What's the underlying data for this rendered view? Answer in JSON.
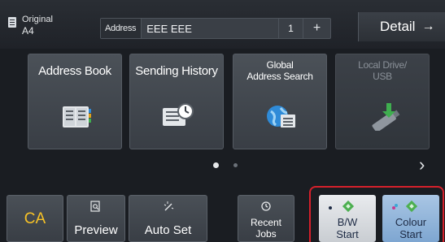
{
  "topbar": {
    "original_label": "Original",
    "original_size": "A4",
    "address_tag": "Address",
    "address_value": "EEE EEE",
    "address_count": "1",
    "add_symbol": "+",
    "detail_label": "Detail",
    "detail_arrow": "→"
  },
  "tiles": [
    {
      "name": "Address Book",
      "icon": "address-book-icon",
      "enabled": true
    },
    {
      "name": "Sending History",
      "icon": "sending-history-icon",
      "enabled": true
    },
    {
      "name_line1": "Global",
      "name_line2": "Address Search",
      "icon": "global-address-search-icon",
      "enabled": true
    },
    {
      "name_line1": "Local Drive/",
      "name_line2": "USB",
      "icon": "usb-drive-icon",
      "enabled": false
    }
  ],
  "pager": {
    "current": 1,
    "total": 2,
    "next_symbol": "›"
  },
  "bottombar": {
    "ca_label": "CA",
    "preview_label": "Preview",
    "autoset_label": "Auto Set",
    "recent_line1": "Recent",
    "recent_line2": "Jobs",
    "bw_line1": "B/W",
    "bw_line2": "Start",
    "colour_line1": "Colour",
    "colour_line2": "Start"
  },
  "colors": {
    "ca_text": "#f7c226",
    "start_highlight_border": "#d6202b",
    "start_icon_green": "#4caf50"
  }
}
